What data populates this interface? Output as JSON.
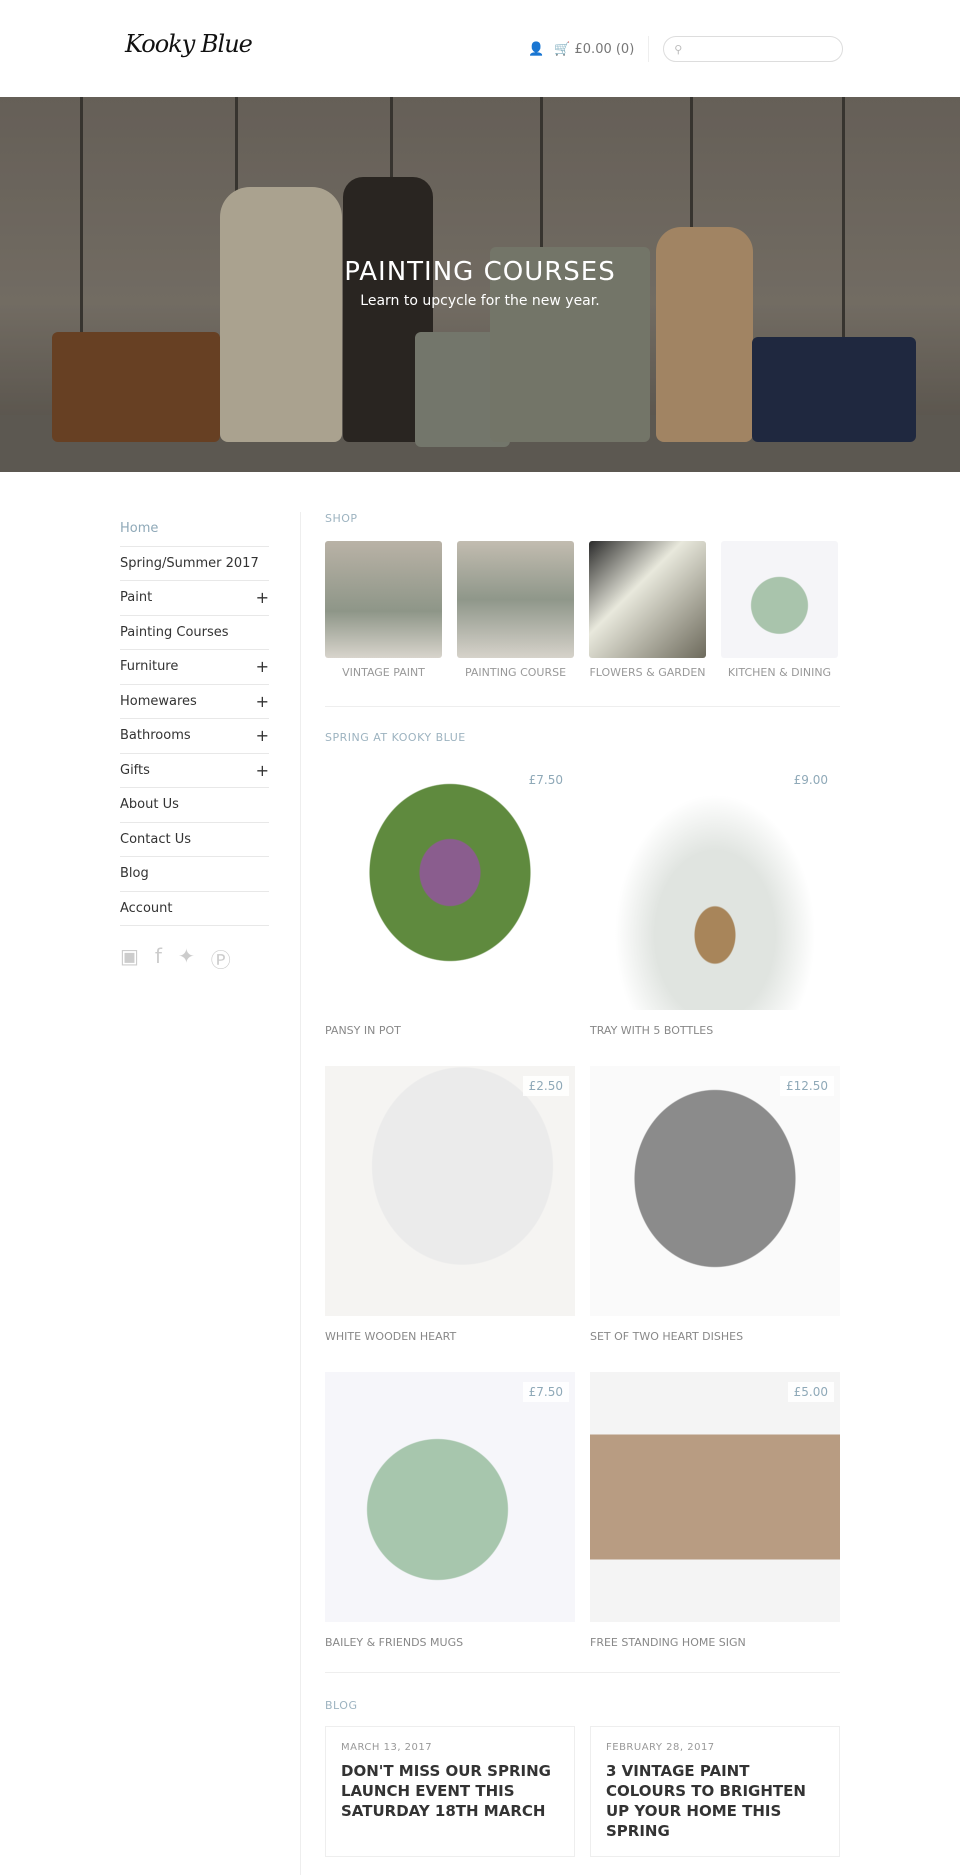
{
  "header": {
    "logo": "Kooky Blue",
    "cart": "£0.00 (0)",
    "search_placeholder": ""
  },
  "hero": {
    "title": "PAINTING COURSES",
    "subtitle": "Learn to upcycle for the new year."
  },
  "sidebar": {
    "items": [
      {
        "label": "Home",
        "active": true,
        "expandable": false
      },
      {
        "label": "Spring/Summer 2017",
        "expandable": false
      },
      {
        "label": "Paint",
        "expandable": true
      },
      {
        "label": "Painting Courses",
        "expandable": false
      },
      {
        "label": "Furniture",
        "expandable": true
      },
      {
        "label": "Homewares",
        "expandable": true
      },
      {
        "label": "Bathrooms",
        "expandable": true
      },
      {
        "label": "Gifts",
        "expandable": true
      },
      {
        "label": "About Us",
        "expandable": false
      },
      {
        "label": "Contact Us",
        "expandable": false
      },
      {
        "label": "Blog",
        "expandable": false
      },
      {
        "label": "Account",
        "expandable": false
      }
    ],
    "plus": "+",
    "social": [
      "instagram-icon",
      "facebook-icon",
      "twitter-icon",
      "pinterest-icon"
    ]
  },
  "shop": {
    "title": "SHOP",
    "tiles": [
      {
        "label": "VINTAGE PAINT"
      },
      {
        "label": "PAINTING COURSE"
      },
      {
        "label": "FLOWERS & GARDEN"
      },
      {
        "label": "KITCHEN & DINING"
      }
    ]
  },
  "spring": {
    "title": "SPRING AT KOOKY BLUE",
    "products": [
      {
        "name": "PANSY IN POT",
        "price": "£7.50"
      },
      {
        "name": "TRAY WITH 5 BOTTLES",
        "price": "£9.00"
      },
      {
        "name": "WHITE WOODEN HEART",
        "price": "£2.50"
      },
      {
        "name": "SET OF TWO HEART DISHES",
        "price": "£12.50"
      },
      {
        "name": "BAILEY & FRIENDS MUGS",
        "price": "£7.50"
      },
      {
        "name": "FREE STANDING HOME SIGN",
        "price": "£5.00"
      }
    ]
  },
  "blog": {
    "title": "BLOG",
    "posts": [
      {
        "date": "MARCH 13, 2017",
        "title": "DON'T MISS OUR SPRING LAUNCH EVENT THIS SATURDAY 18TH MARCH"
      },
      {
        "date": "FEBRUARY 28, 2017",
        "title": "3 VINTAGE PAINT COLOURS TO BRIGHTEN UP YOUR HOME THIS SPRING"
      }
    ]
  },
  "colors": {
    "accent": "#8fa9b8"
  }
}
